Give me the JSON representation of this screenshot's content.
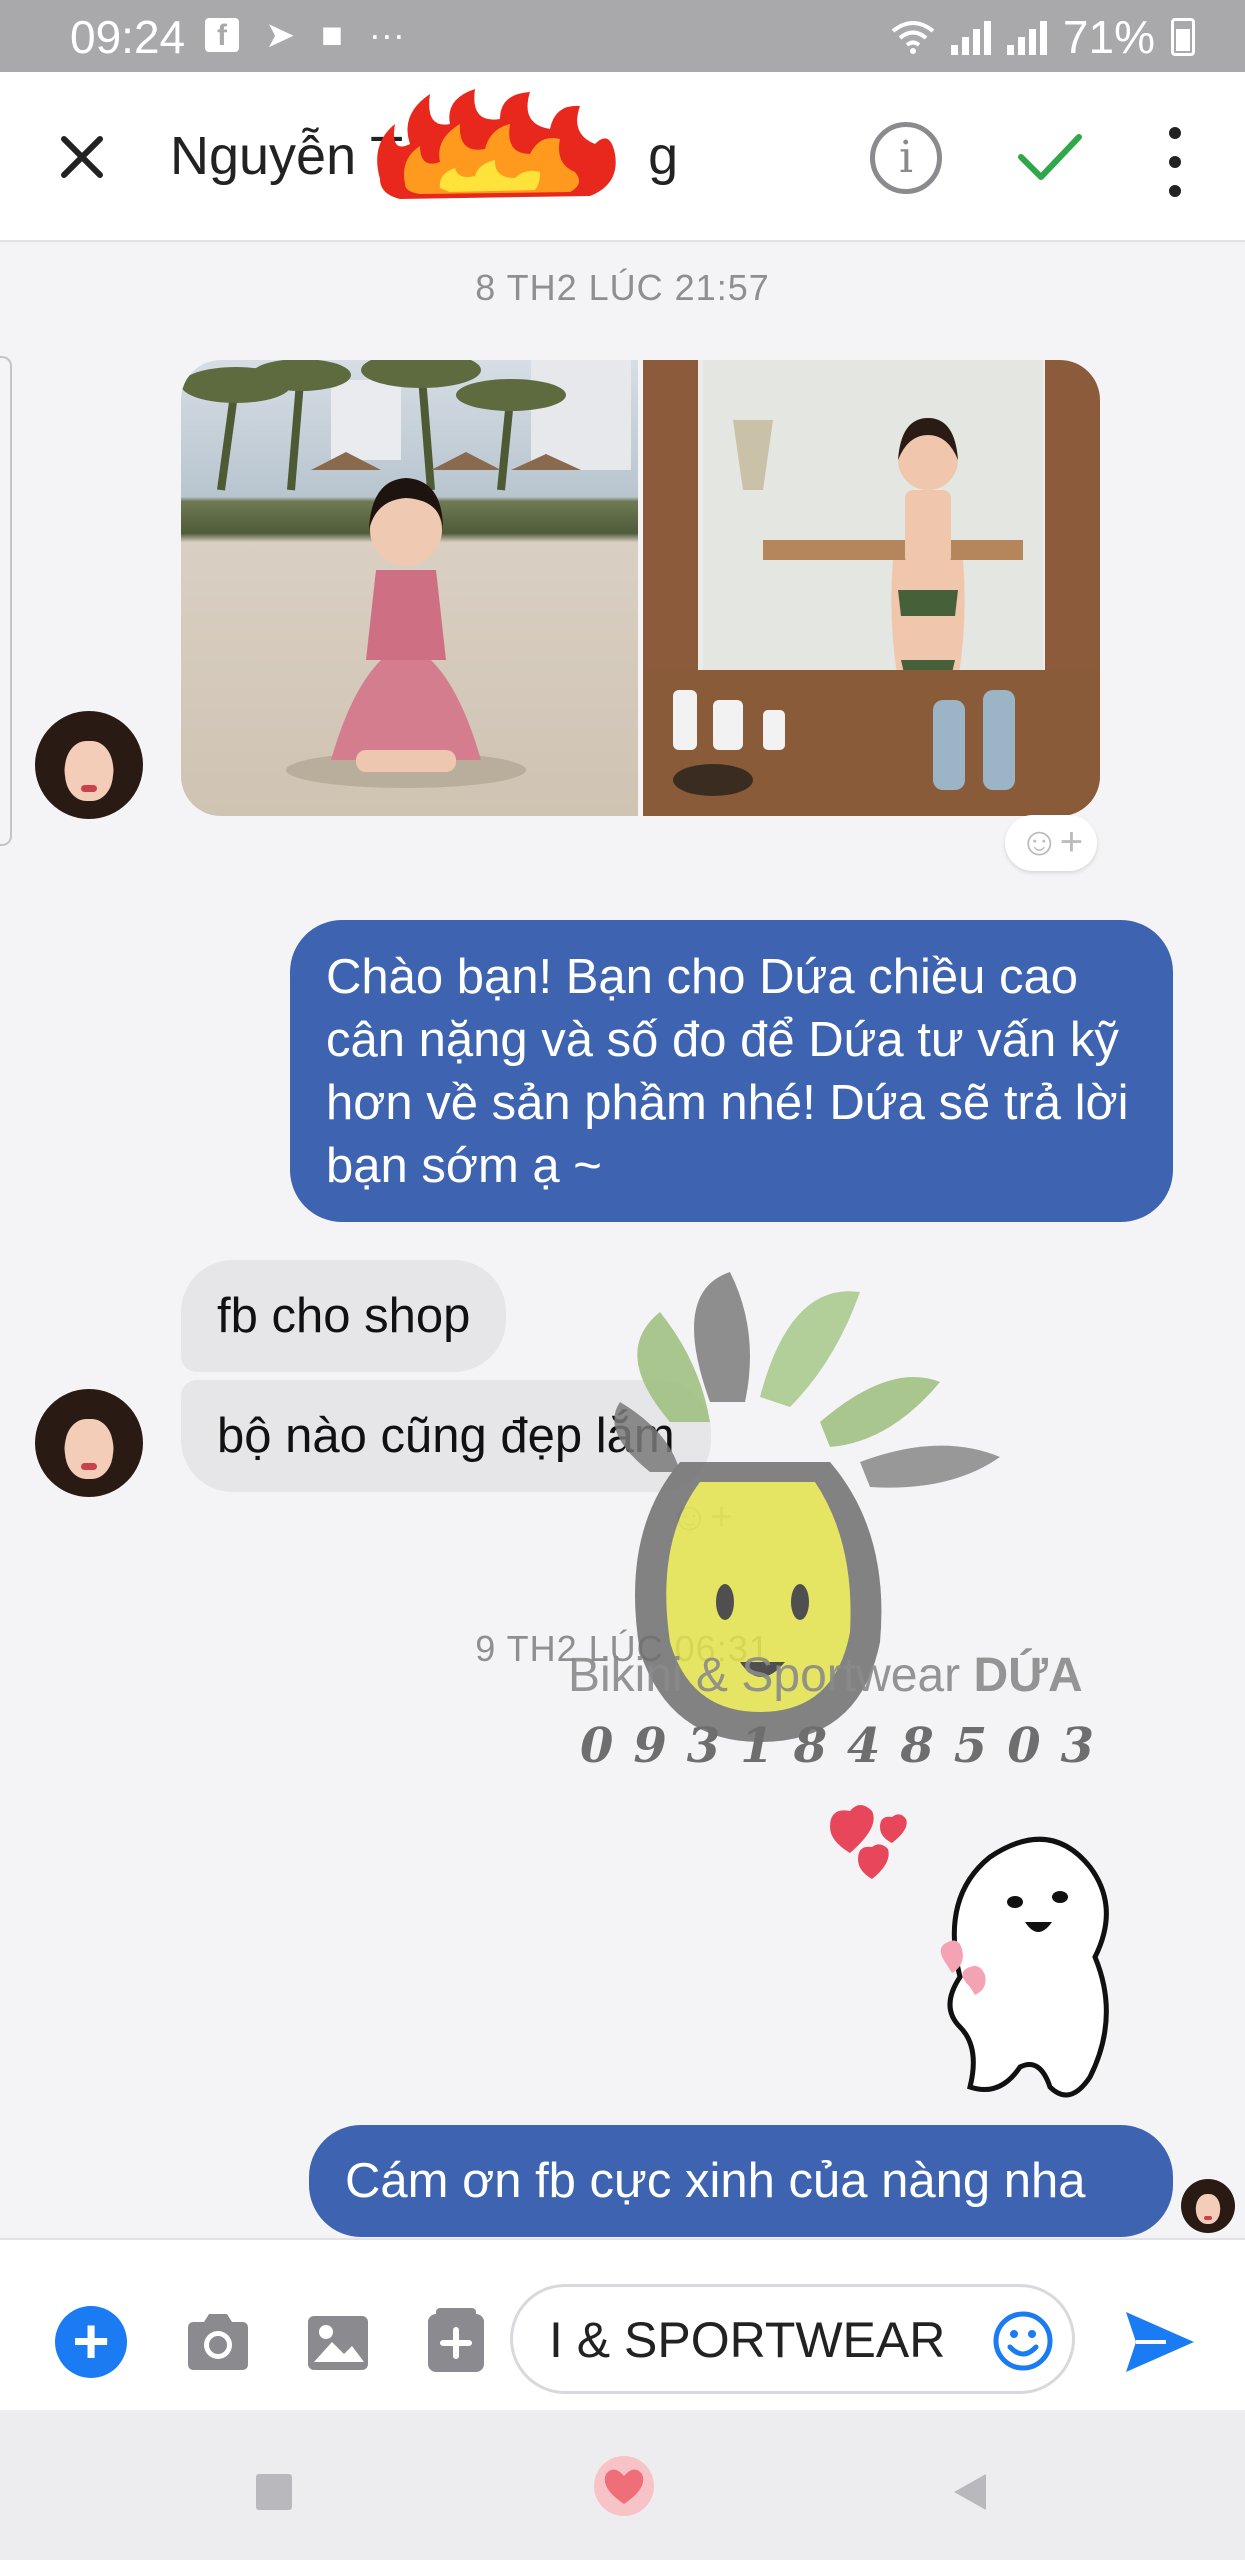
{
  "status_bar": {
    "time": "09:24",
    "icons": [
      "facebook-icon",
      "navigation-icon",
      "message-icon",
      "more-notifications-icon"
    ],
    "more_glyph": "···",
    "battery": "71%"
  },
  "header": {
    "contact_name": "Nguyễn T",
    "contact_name_tail": "g",
    "icons": [
      "close-icon",
      "info-icon",
      "check-icon",
      "more-vertical-icon"
    ],
    "info_glyph": "i"
  },
  "chat": {
    "timestamp_1": "8 TH2 LÚC 21:57",
    "incoming_photos": [
      "beach-photo",
      "mirror-selfie-photo"
    ],
    "outgoing_1": "Chào bạn! Bạn cho Dứa chiều cao cân nặng và số đo để Dứa tư vấn kỹ hơn về sản phầm nhé! Dứa sẽ trả lời bạn sớm ạ ~",
    "incoming_1": "fb cho shop",
    "incoming_2": "bộ nào cũng đẹp lắm",
    "timestamp_2": "9 TH2 LÚC 06:31",
    "outgoing_2": "Cám ơn fb cực xinh của nàng nha",
    "reaction_glyph": "☺+"
  },
  "watermark": {
    "brand_prefix": "Bikini & Sportwear ",
    "brand_bold": "DỨA",
    "phone": "0931848503"
  },
  "composer": {
    "input_value": "I & SPORTWEAR",
    "plus_glyph": "+",
    "icons": [
      "add-icon",
      "camera-icon",
      "gallery-icon",
      "sticker-icon",
      "emoji-icon",
      "send-icon"
    ]
  },
  "colors": {
    "outgoing_bubble": "#3e64b1",
    "incoming_bubble": "#e6e6e9",
    "accent_blue": "#1a7bf2",
    "check_green": "#2ea84a"
  }
}
